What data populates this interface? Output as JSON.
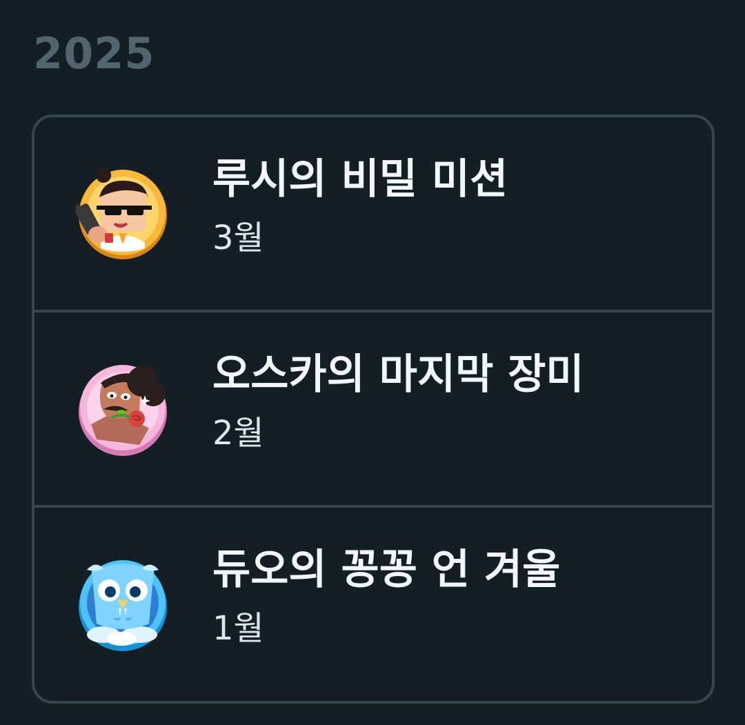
{
  "year": "2025",
  "colors": {
    "background": "#131f24",
    "border": "#37464f",
    "year_text": "#52656d",
    "title_text": "#f1f7fb",
    "subtitle_text": "#dce6ec"
  },
  "items": [
    {
      "title": "루시의 비밀 미션",
      "month": "3월",
      "icon": "lucy-spy-badge-icon",
      "accent": "#f5a623"
    },
    {
      "title": "오스카의 마지막 장미",
      "month": "2월",
      "icon": "oscar-rose-badge-icon",
      "accent": "#f2a7d4"
    },
    {
      "title": "듀오의 꽁꽁 언 겨울",
      "month": "1월",
      "icon": "duo-frozen-badge-icon",
      "accent": "#49c0f8"
    }
  ]
}
